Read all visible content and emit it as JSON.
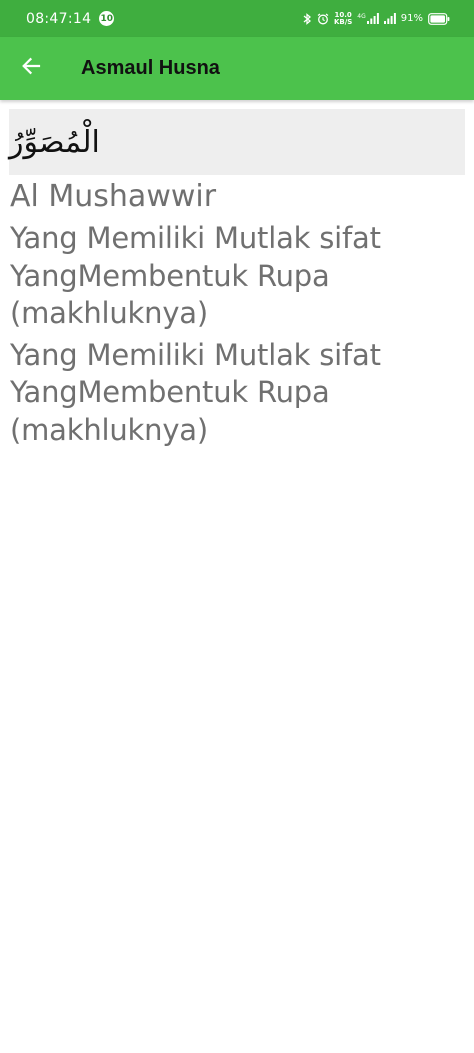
{
  "status_bar": {
    "time": "08:47:14",
    "notification_count": "10",
    "net_speed_top": "10.0",
    "net_speed_bottom": "KB/S",
    "network_type": "4G",
    "battery_percent": "91%",
    "icons": [
      "bluetooth-icon",
      "alarm-icon",
      "signal-icon",
      "signal-icon",
      "battery-icon"
    ]
  },
  "app_bar": {
    "back_icon": "arrow-left-icon",
    "title": "Asmaul Husna",
    "color": "#4cc24c"
  },
  "detail": {
    "arabic": "الْمُصَوِّرُ",
    "latin": "Al Mushawwir",
    "meaning_1": "Yang Memiliki Mutlak sifat YangMembentuk Rupa (makhluknya)",
    "meaning_2": "Yang Memiliki Mutlak sifat YangMembentuk Rupa (makhluknya)"
  }
}
